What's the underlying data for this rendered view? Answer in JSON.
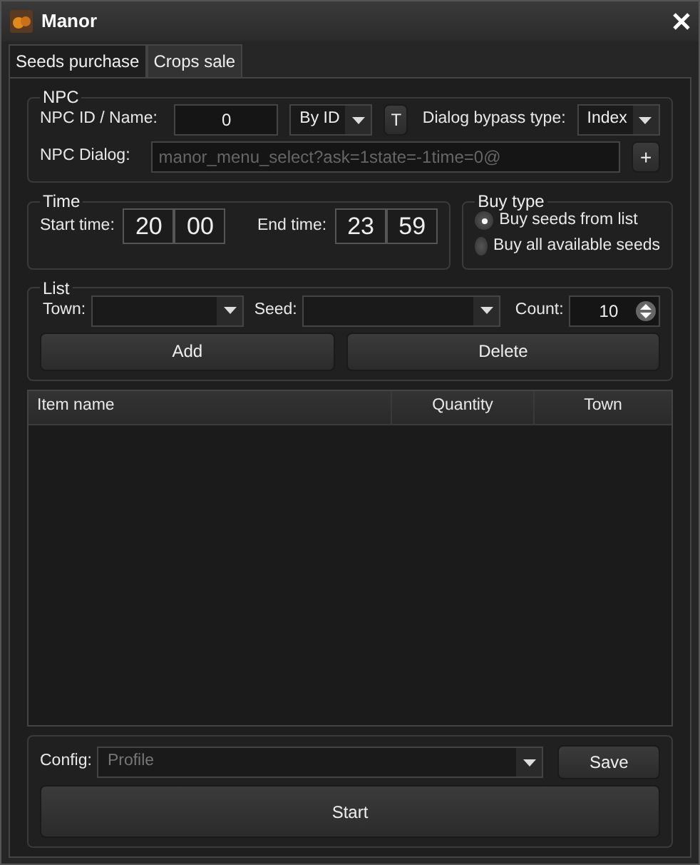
{
  "window": {
    "title": "Manor"
  },
  "tabs": [
    {
      "label": "Seeds purchase",
      "selected": true
    },
    {
      "label": "Crops sale",
      "selected": false
    }
  ],
  "npc": {
    "title": "NPC",
    "id_label": "NPC ID / Name:",
    "id_value": "0",
    "mode": "By ID",
    "t_button": "T",
    "bypass_label": "Dialog bypass type:",
    "bypass_value": "Index",
    "dialog_label": "NPC Dialog:",
    "dialog_value": "manor_menu_select?ask=1state=-1time=0@",
    "dialog_disabled": true,
    "add_button": "+"
  },
  "time": {
    "title": "Time",
    "start_label": "Start time:",
    "start_hour": "20",
    "start_minute": "00",
    "end_label": "End time:",
    "end_hour": "23",
    "end_minute": "59"
  },
  "buy_type": {
    "title": "Buy type",
    "options": [
      {
        "label": "Buy seeds from list",
        "selected": true
      },
      {
        "label": "Buy all available seeds",
        "selected": false
      }
    ]
  },
  "list": {
    "title": "List",
    "town_label": "Town:",
    "seed_label": "Seed:",
    "count_label": "Count:",
    "count_value": "10",
    "buttons": [
      "Add",
      "Delete"
    ]
  },
  "table": {
    "columns": [
      "Item name",
      "Quantity",
      "Town"
    ]
  },
  "config": {
    "label": "Config:",
    "placeholder": "Profile",
    "save_button": "Save",
    "start_button": "Start"
  }
}
